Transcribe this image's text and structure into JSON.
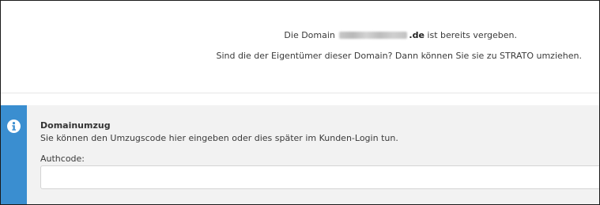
{
  "message": {
    "line1_prefix": "Die Domain",
    "line1_domain_tld": ".de",
    "line1_suffix": "ist bereits vergeben.",
    "line2": "Sind die der Eigentümer dieser Domain? Dann können Sie sie zu STRATO umziehen."
  },
  "panel": {
    "icon": "info-icon",
    "accent_color": "#3a8ed0",
    "title": "Domainumzug",
    "description": "Sie können den Umzugscode hier eingeben oder dies später im Kunden-Login tun.",
    "authcode_label": "Authcode:",
    "authcode_value": "",
    "authcode_placeholder": ""
  }
}
